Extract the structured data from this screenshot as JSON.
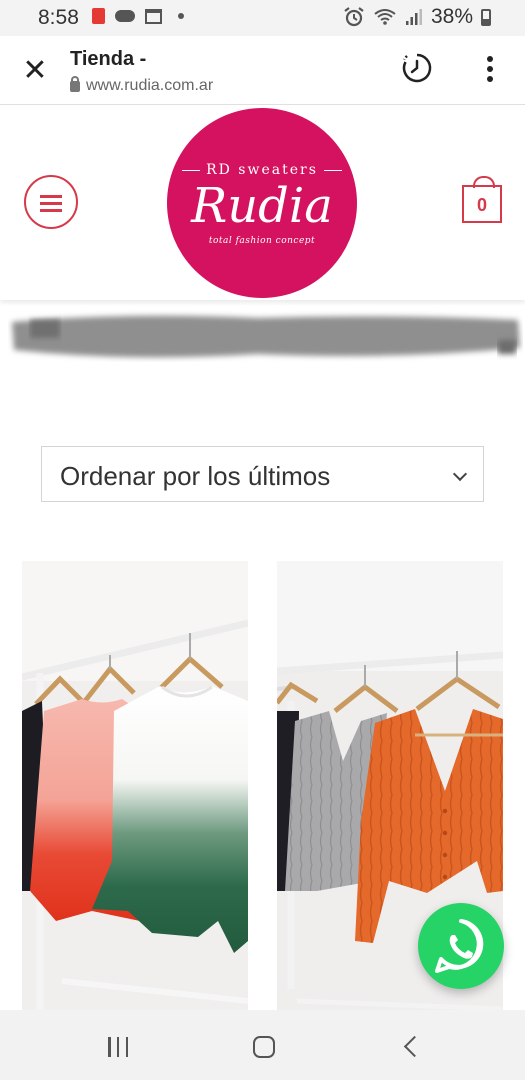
{
  "status_bar": {
    "time": "8:58",
    "battery": "38%",
    "icons": [
      "pdf-icon",
      "cloud-icon",
      "calendar-icon",
      "dot-icon",
      "alarm-icon",
      "wifi-icon",
      "signal-icon",
      "battery-icon"
    ]
  },
  "browser": {
    "title": "Tienda -",
    "url": "www.rudia.com.ar",
    "icons": [
      "close-icon",
      "lock-icon",
      "history-icon",
      "more-vert-icon"
    ]
  },
  "site": {
    "logo": {
      "top": "RD sweaters",
      "name": "Rudia",
      "tagline": "total fashion concept"
    },
    "cart_count": "0",
    "colors": {
      "brand": "#d5125f",
      "accent": "#d6394a",
      "whatsapp": "#25d366"
    }
  },
  "sort": {
    "selected": "Ordenar por los últimos"
  },
  "products": [
    {
      "image": "ombre sweaters on hangers (pink-red and white-green)"
    },
    {
      "image": "grey and orange cardigans on hangers"
    }
  ],
  "nav": {
    "icons": [
      "recents-icon",
      "home-icon",
      "back-icon"
    ]
  }
}
